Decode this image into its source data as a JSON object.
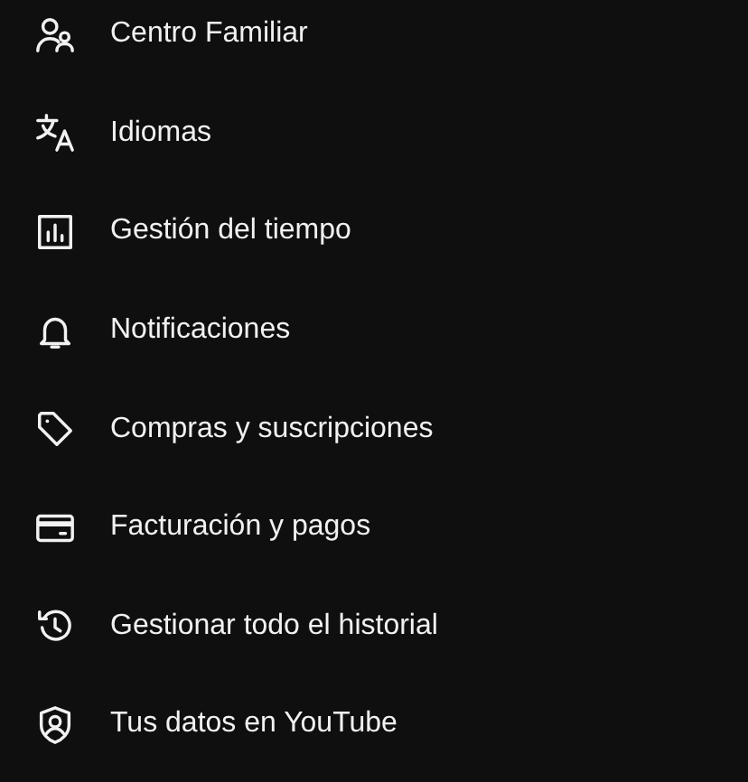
{
  "menu": {
    "items": [
      {
        "label": "Centro Familiar"
      },
      {
        "label": "Idiomas"
      },
      {
        "label": "Gestión del tiempo"
      },
      {
        "label": "Notificaciones"
      },
      {
        "label": "Compras y suscripciones"
      },
      {
        "label": "Facturación y pagos"
      },
      {
        "label": "Gestionar todo el historial"
      },
      {
        "label": "Tus datos en YouTube"
      }
    ]
  }
}
